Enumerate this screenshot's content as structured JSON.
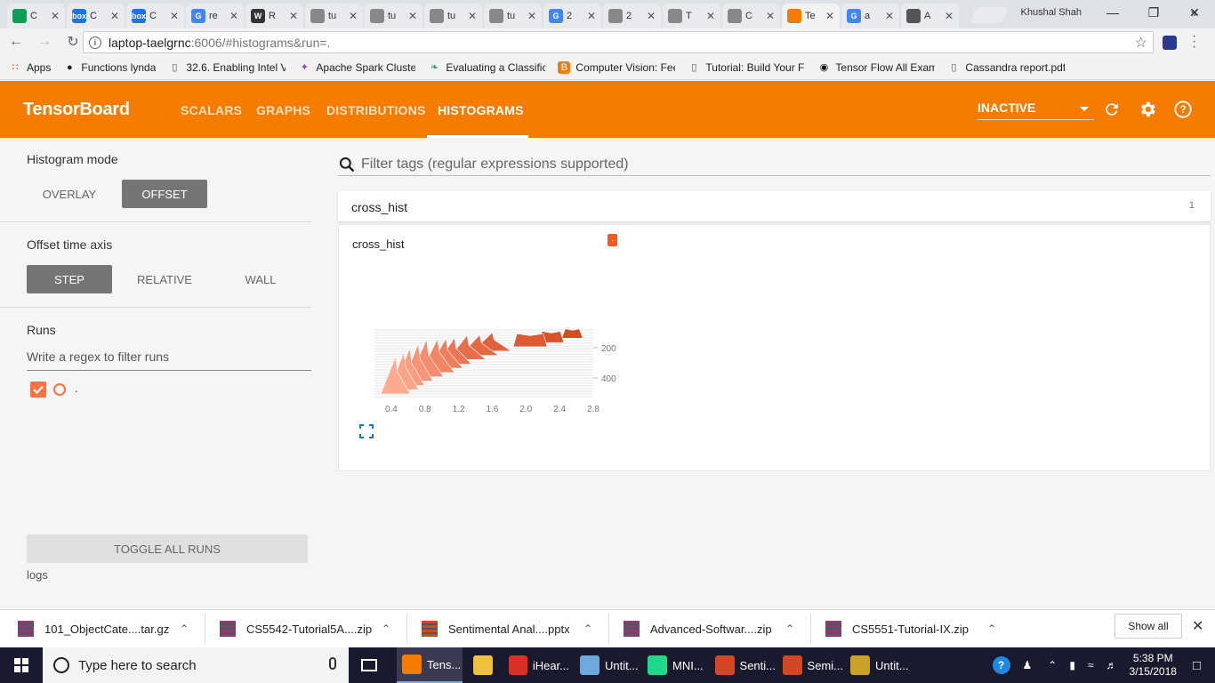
{
  "browser": {
    "tabs": [
      {
        "icon_text": "",
        "color": "#0f9d58",
        "title": "C"
      },
      {
        "icon_text": "box",
        "color": "#1a73e8",
        "title": "C"
      },
      {
        "icon_text": "box",
        "color": "#1a73e8",
        "title": "C"
      },
      {
        "icon_text": "G",
        "color": "#4285f4",
        "title": "re"
      },
      {
        "icon_text": "W",
        "color": "#333333",
        "title": "R"
      },
      {
        "icon_text": "",
        "color": "#888888",
        "title": "tu"
      },
      {
        "icon_text": "",
        "color": "#888888",
        "title": "tu"
      },
      {
        "icon_text": "",
        "color": "#888888",
        "title": "tu"
      },
      {
        "icon_text": "",
        "color": "#888888",
        "title": "tu"
      },
      {
        "icon_text": "G",
        "color": "#4285f4",
        "title": "2"
      },
      {
        "icon_text": "",
        "color": "#888888",
        "title": "2"
      },
      {
        "icon_text": "",
        "color": "#888888",
        "title": "T"
      },
      {
        "icon_text": "",
        "color": "#888888",
        "title": "C"
      },
      {
        "icon_text": "",
        "color": "#f57c00",
        "title": "Te"
      },
      {
        "icon_text": "G",
        "color": "#4285f4",
        "title": "a"
      },
      {
        "icon_text": "",
        "color": "#555555",
        "title": "A"
      }
    ],
    "active_tab_index": 13,
    "profile_name": "Khushal Shah",
    "url_host": "laptop-taelgrnc",
    "url_path": ":6006/#histograms&run=.",
    "bookmarks": [
      {
        "label": "Apps",
        "icon": "apps-grid-icon"
      },
      {
        "label": "Functions lynda",
        "icon": "lynda-icon"
      },
      {
        "label": "32.6. Enabling Intel V",
        "icon": "page-icon"
      },
      {
        "label": "Apache Spark Cluster",
        "icon": "spark-icon"
      },
      {
        "label": "Evaluating a Classifica",
        "icon": "leaf-icon"
      },
      {
        "label": "Computer Vision: Fee",
        "icon": "blogger-icon"
      },
      {
        "label": "Tutorial: Build Your Fi",
        "icon": "page-icon"
      },
      {
        "label": "Tensor Flow All Examp",
        "icon": "github-icon"
      },
      {
        "label": "Cassandra report.pdf",
        "icon": "page-icon"
      }
    ],
    "more_bookmarks": "»"
  },
  "tensorboard": {
    "title": "TensorBoard",
    "tabs": [
      "SCALARS",
      "GRAPHS",
      "DISTRIBUTIONS",
      "HISTOGRAMS"
    ],
    "active_tab": "HISTOGRAMS",
    "run_status": "INACTIVE",
    "colors": {
      "header": "#f57c00",
      "run": "#ff7043"
    }
  },
  "sidebar": {
    "histogram_mode_label": "Histogram mode",
    "histogram_modes": [
      "OVERLAY",
      "OFFSET"
    ],
    "histogram_mode_selected": "OFFSET",
    "time_axis_label": "Offset time axis",
    "time_axis_options": [
      "STEP",
      "RELATIVE",
      "WALL"
    ],
    "time_axis_selected": "STEP",
    "runs_label": "Runs",
    "runs_filter_placeholder": "Write a regex to filter runs",
    "runs": [
      {
        "name": ".",
        "checked": true
      }
    ],
    "toggle_all_label": "TOGGLE ALL RUNS",
    "logdir": "logs"
  },
  "main": {
    "filter_placeholder": "Filter tags (regular expressions supported)",
    "category": {
      "name": "cross_hist",
      "count": "1"
    },
    "card": {
      "title": "cross_hist",
      "run_tag": "."
    }
  },
  "chart_data": {
    "type": "area",
    "title": "cross_hist",
    "x_ticks": [
      "0.4",
      "0.8",
      "1.2",
      "1.6",
      "2.0",
      "2.4",
      "2.8"
    ],
    "y_ticks": [
      "200",
      "400"
    ],
    "xlim": [
      0.2,
      2.8
    ],
    "ylim": [
      0,
      500
    ],
    "series": [
      {
        "step": 0,
        "peak_x": 0.45,
        "width": 0.35,
        "height": 1.0
      },
      {
        "step": 40,
        "peak_x": 0.55,
        "width": 0.35,
        "height": 1.0
      },
      {
        "step": 80,
        "peak_x": 0.62,
        "width": 0.35,
        "height": 1.0
      },
      {
        "step": 120,
        "peak_x": 0.72,
        "width": 0.35,
        "height": 1.0
      },
      {
        "step": 160,
        "peak_x": 0.82,
        "width": 0.4,
        "height": 1.0
      },
      {
        "step": 200,
        "peak_x": 0.95,
        "width": 0.4,
        "height": 0.9
      },
      {
        "step": 240,
        "peak_x": 1.05,
        "width": 0.4,
        "height": 0.8
      },
      {
        "step": 280,
        "peak_x": 1.15,
        "width": 0.4,
        "height": 0.7
      },
      {
        "step": 320,
        "peak_x": 1.3,
        "width": 0.45,
        "height": 0.65
      },
      {
        "step": 360,
        "peak_x": 1.45,
        "width": 0.45,
        "height": 0.55
      },
      {
        "step": 400,
        "peak_x": 1.6,
        "width": 0.45,
        "height": 0.5
      },
      {
        "step": 440,
        "peak_x": 2.05,
        "width": 0.4,
        "height": 0.35
      },
      {
        "step": 460,
        "peak_x": 2.3,
        "width": 0.3,
        "height": 0.3
      },
      {
        "step": 480,
        "peak_x": 2.55,
        "width": 0.25,
        "height": 0.25
      }
    ]
  },
  "downloads": {
    "items": [
      "101_ObjectCate....tar.gz",
      "CS5542-Tutorial5A....zip",
      "Sentimental Anal....pptx",
      "Advanced-Softwar....zip",
      "CS5551-Tutorial-IX.zip"
    ],
    "show_all_label": "Show all"
  },
  "taskbar": {
    "search_placeholder": "Type here to search",
    "apps": [
      {
        "label": "Tens...",
        "color": "#f57c00"
      },
      {
        "label": "",
        "color": "#f0c040"
      },
      {
        "label": "iHear...",
        "color": "#d93025"
      },
      {
        "label": "Untit...",
        "color": "#6fa8dc"
      },
      {
        "label": "MNI...",
        "color": "#21d789"
      },
      {
        "label": "Senti...",
        "color": "#d24726"
      },
      {
        "label": "Semi...",
        "color": "#d24726"
      },
      {
        "label": "Untit...",
        "color": "#c9a227"
      }
    ],
    "time": "5:38 PM",
    "date": "3/15/2018"
  }
}
